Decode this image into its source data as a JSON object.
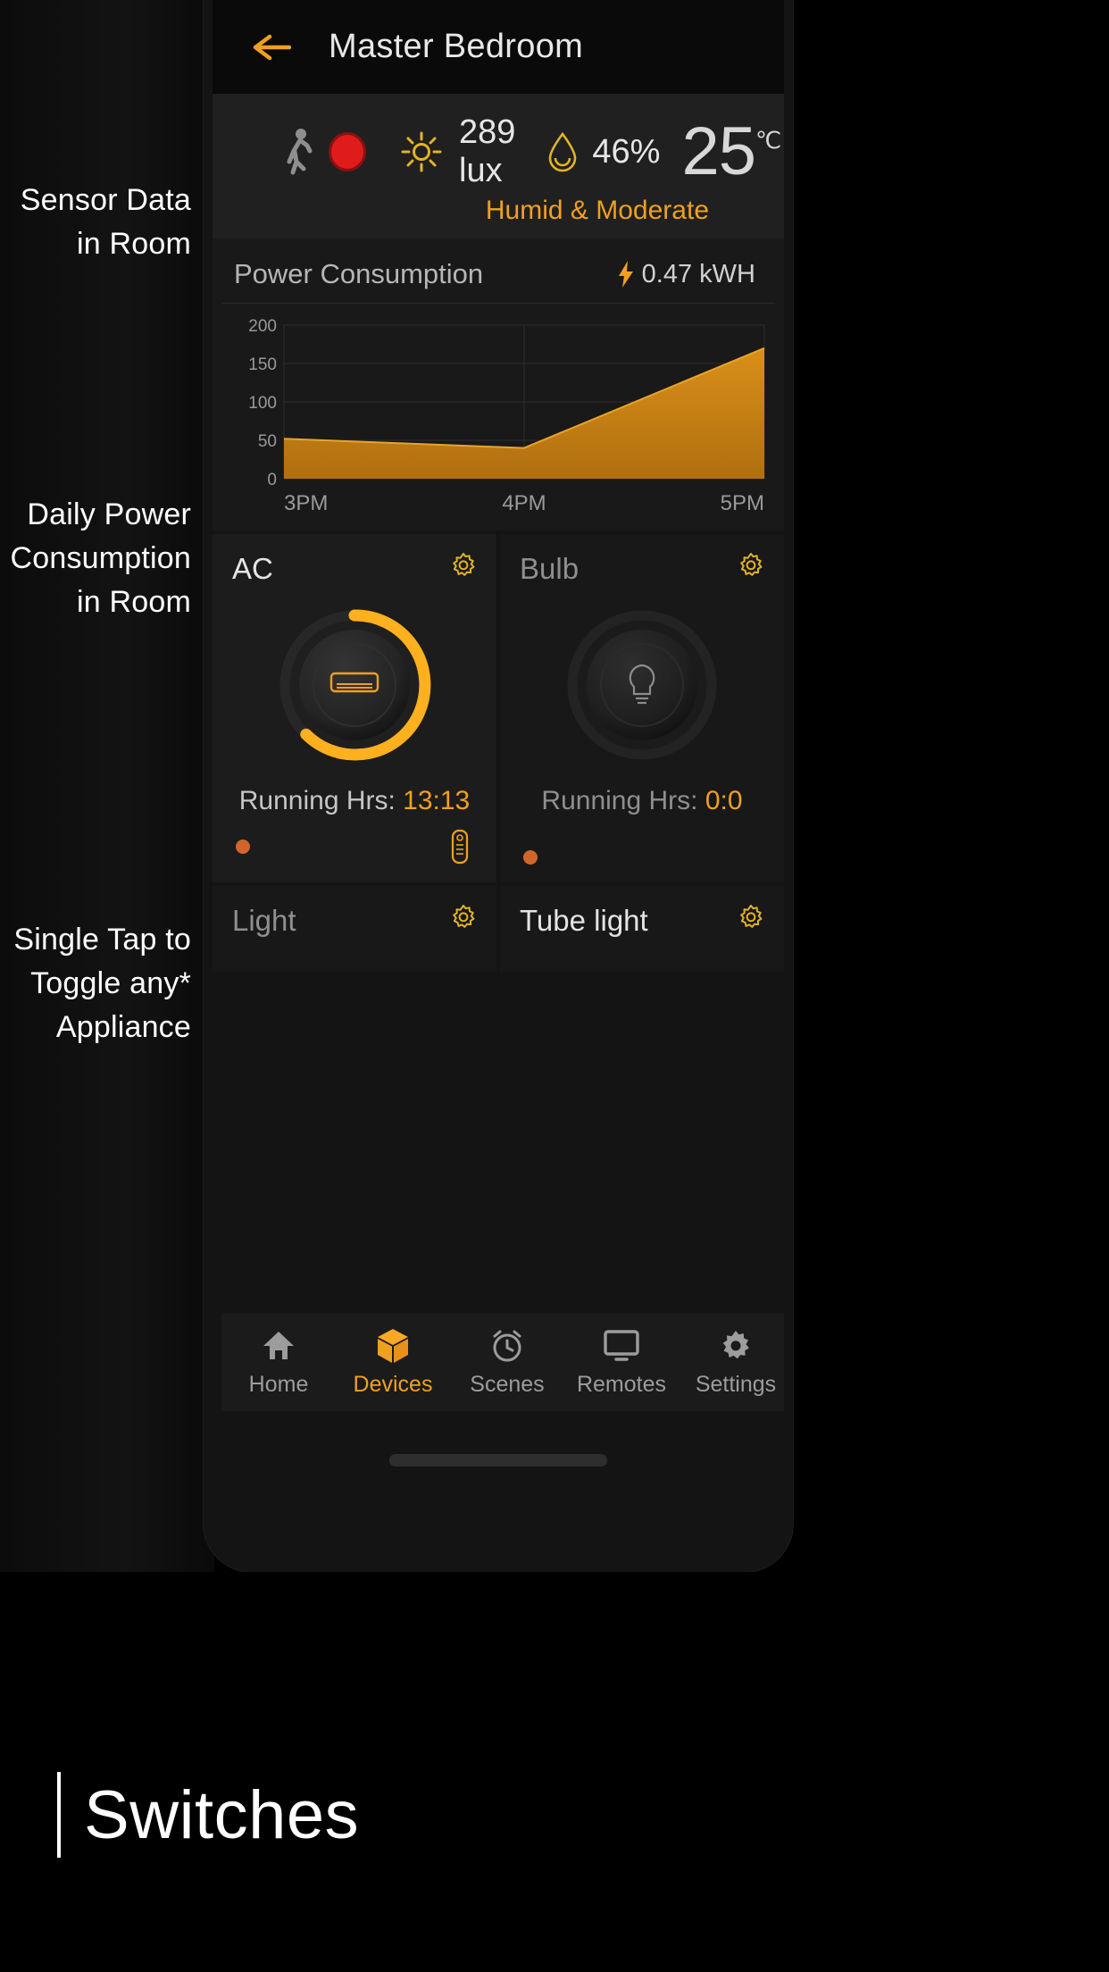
{
  "annotations": {
    "sensor": "Sensor Data\nin Room",
    "sensor_line1": "Sensor Data",
    "sensor_line2": "in Room",
    "power_line1": "Daily Power",
    "power_line2": "Consumption",
    "power_line3": "in Room",
    "toggle_line1": "Single Tap to",
    "toggle_line2": "Toggle any*",
    "toggle_line3": "Appliance"
  },
  "header": {
    "title": "Master Bedroom",
    "back_icon": "arrow-left-icon",
    "accent": "#f0a020"
  },
  "sensors": {
    "motion_icon": "walking-person-icon",
    "motion_state_icon": "red-dot-icon",
    "motion_color": "#e01b1b",
    "light_icon": "sun-icon",
    "light_value": "289 lux",
    "humidity_icon": "water-drop-icon",
    "humidity_value": "46%",
    "temperature_value": "25",
    "temperature_unit": "℃",
    "comfort_caption": "Humid & Moderate",
    "caption_color": "#f0a020"
  },
  "power": {
    "title": "Power Consumption",
    "bolt_icon": "lightning-bolt-icon",
    "total": "0.47 kWH"
  },
  "chart_data": {
    "type": "area",
    "title": "Power Consumption",
    "xlabel": "",
    "ylabel": "",
    "x": [
      "3PM",
      "4PM",
      "5PM"
    ],
    "categories": [
      "3PM",
      "4PM",
      "5PM"
    ],
    "values": [
      52,
      40,
      170
    ],
    "series": [
      {
        "name": "Power",
        "values": [
          52,
          40,
          170
        ]
      }
    ],
    "yticks": [
      0,
      50,
      100,
      150,
      200
    ],
    "ylim": [
      0,
      200
    ],
    "grid": true,
    "legend": "none",
    "fill_color": "#c47a13",
    "line_color": "#e49a20"
  },
  "devices": [
    {
      "name": "AC",
      "gear_icon": "gear-icon",
      "glyph_icon": "air-conditioner-icon",
      "state": "on",
      "dial_percent": 72,
      "hrs_label": "Running Hrs:",
      "hrs_value": "13:13",
      "status_dot": "#d2662a",
      "remote_icon": "remote-control-icon"
    },
    {
      "name": "Bulb",
      "gear_icon": "gear-icon",
      "glyph_icon": "bulb-icon",
      "state": "off",
      "dial_percent": 0,
      "hrs_label": "Running Hrs:",
      "hrs_value": "0:0",
      "status_dot": "#d2662a",
      "remote_icon": ""
    },
    {
      "name": "Light",
      "gear_icon": "gear-icon",
      "glyph_icon": "light-icon",
      "state": "off",
      "dial_percent": 0,
      "hrs_label": "",
      "hrs_value": "",
      "status_dot": "#d2662a",
      "remote_icon": ""
    },
    {
      "name": "Tube light",
      "gear_icon": "gear-icon",
      "glyph_icon": "tube-light-icon",
      "state": "off",
      "dial_percent": 0,
      "hrs_label": "",
      "hrs_value": "",
      "status_dot": "#d2662a",
      "remote_icon": ""
    }
  ],
  "bottom_nav": {
    "items": [
      {
        "label": "Home",
        "icon": "home-icon",
        "active": false
      },
      {
        "label": "Devices",
        "icon": "cube-icon",
        "active": true
      },
      {
        "label": "Scenes",
        "icon": "alarm-clock-icon",
        "active": false
      },
      {
        "label": "Remotes",
        "icon": "monitor-icon",
        "active": false
      },
      {
        "label": "Settings",
        "icon": "gear-icon",
        "active": false
      }
    ],
    "active_color": "#f0a020",
    "inactive_color": "#9c9c9c"
  },
  "footer": {
    "brand": "Switches"
  }
}
